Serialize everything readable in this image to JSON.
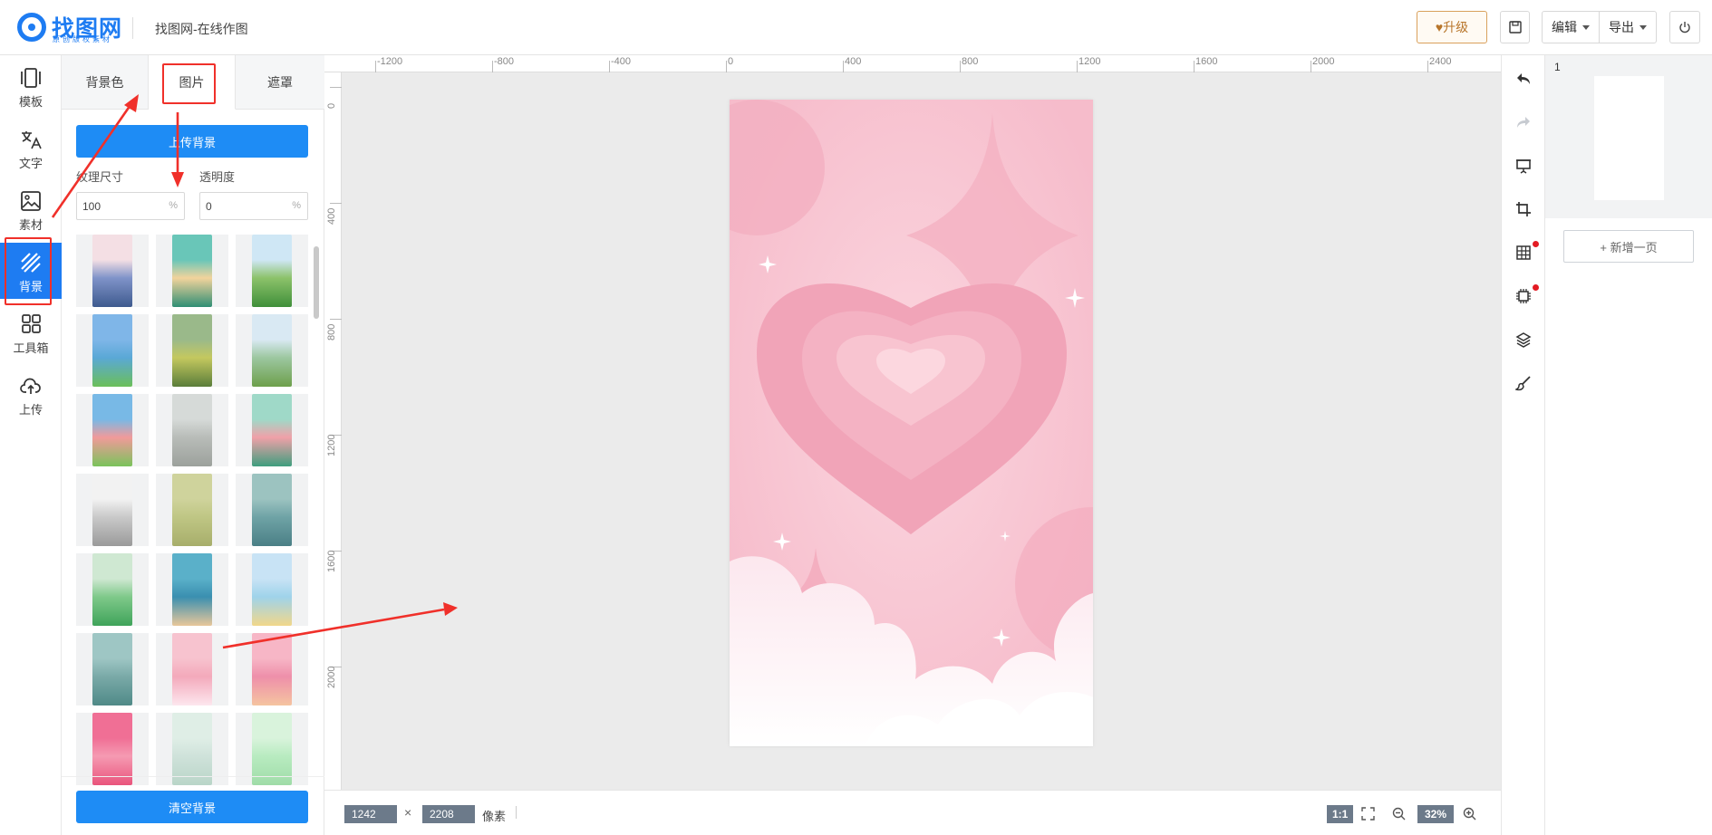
{
  "header": {
    "logo_text": "找图网",
    "logo_sub": "原创版权素材",
    "app_title": "找图网-在线作图",
    "upgrade_label": "♥升级",
    "edit_label": "编辑",
    "export_label": "导出"
  },
  "leftnav": {
    "items": [
      {
        "label": "模板"
      },
      {
        "label": "文字"
      },
      {
        "label": "素材"
      },
      {
        "label": "背景"
      },
      {
        "label": "工具箱"
      },
      {
        "label": "上传"
      }
    ],
    "active": "背景"
  },
  "panel": {
    "tabs": [
      {
        "label": "背景色"
      },
      {
        "label": "图片"
      },
      {
        "label": "遮罩"
      }
    ],
    "active_tab": "图片",
    "upload_label": "上传背景",
    "texture_size_label": "纹理尺寸",
    "opacity_label": "透明度",
    "texture_size_value": "100",
    "opacity_value": "0",
    "unit": "%",
    "clear_label": "清空背景"
  },
  "ruler": {
    "top_labels": [
      "-1200",
      "-800",
      "-400",
      "0",
      "400",
      "800",
      "1200",
      "1600",
      "2000",
      "2400"
    ],
    "left_labels": [
      "0",
      "400",
      "800",
      "1200",
      "1600",
      "2000"
    ]
  },
  "status": {
    "width": "1242",
    "height": "2208",
    "times": "×",
    "unit_label": "像素",
    "ratio_label": "1:1",
    "zoom": "32%"
  },
  "pages": {
    "page_number": "1",
    "add_page_label": "+ 新增一页"
  },
  "colors": {
    "brand_blue": "#1e7cf2",
    "button_blue": "#1e8cf5",
    "annotation_red": "#f0302a",
    "design_pink": "#f7c3cf",
    "heart_pink": "#f3a9bb"
  }
}
